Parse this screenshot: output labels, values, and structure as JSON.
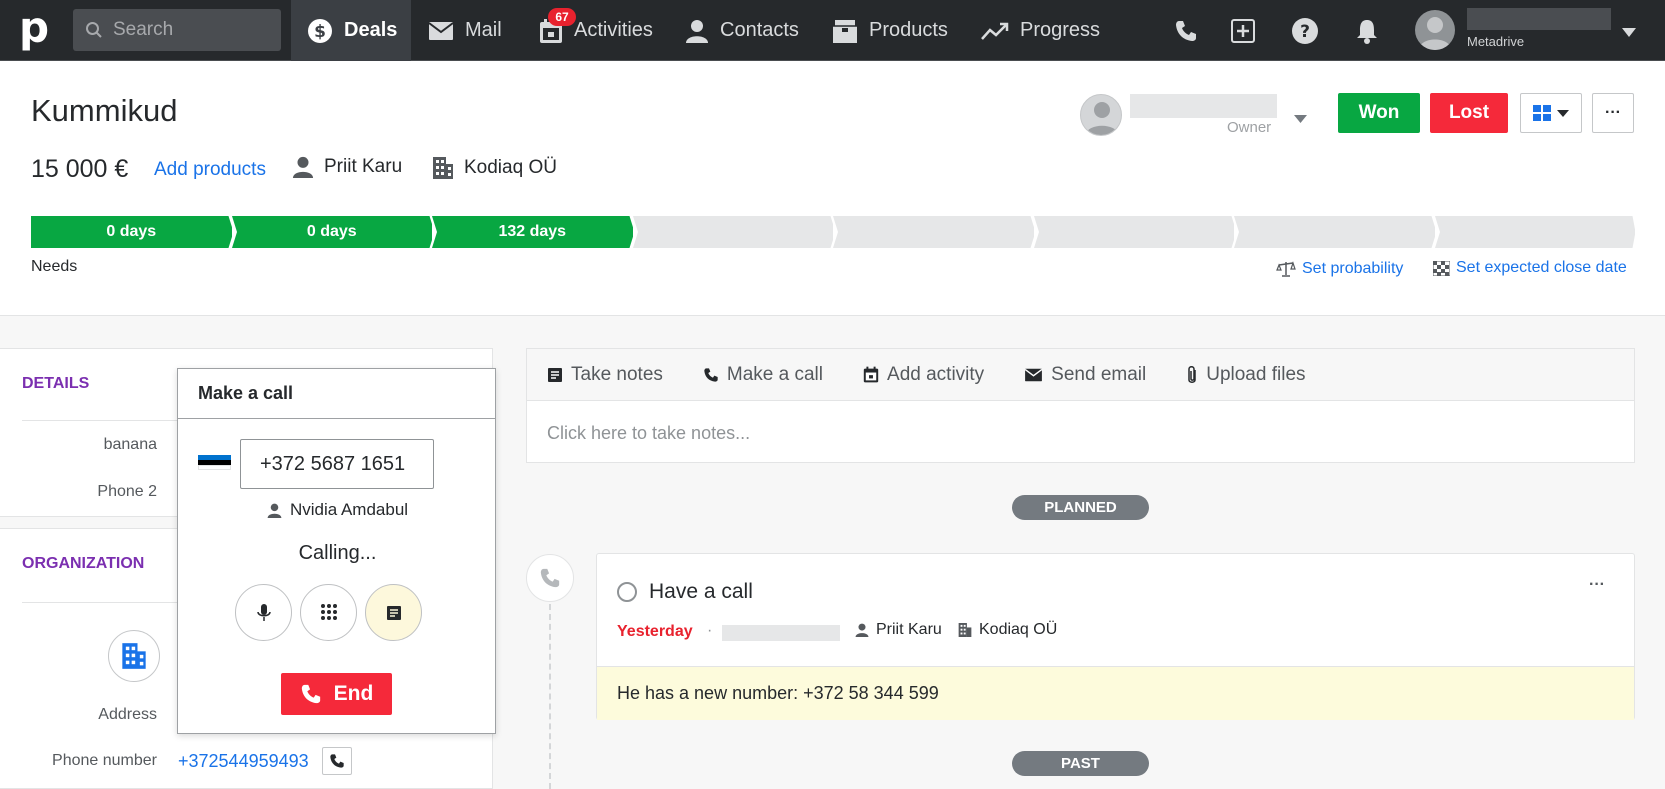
{
  "nav": {
    "search_placeholder": "Search",
    "items": [
      {
        "label": "Deals",
        "icon": "dollar-icon"
      },
      {
        "label": "Mail",
        "icon": "mail-icon"
      },
      {
        "label": "Activities",
        "icon": "calendar-icon",
        "badge": "67"
      },
      {
        "label": "Contacts",
        "icon": "person-icon"
      },
      {
        "label": "Products",
        "icon": "box-icon"
      },
      {
        "label": "Progress",
        "icon": "trend-icon"
      }
    ],
    "user_company": "Metadrive"
  },
  "deal": {
    "title": "Kummikud",
    "value": "15 000 €",
    "add_products": "Add products",
    "person": "Priit Karu",
    "organization": "Kodiaq OÜ",
    "owner_label": "Owner",
    "won": "Won",
    "lost": "Lost",
    "more": "···"
  },
  "pipeline": {
    "stages": [
      "0 days",
      "0 days",
      "132 days",
      "",
      "",
      "",
      "",
      ""
    ],
    "completed_count": 3,
    "current_stage_name": "Needs",
    "set_probability": "Set probability",
    "set_close_date": "Set expected close date"
  },
  "sidebar": {
    "details_title": "DETAILS",
    "details_fields": [
      "banana",
      "Phone 2"
    ],
    "org_title": "ORGANIZATION",
    "org_fields": [
      "Address",
      "Phone number"
    ],
    "phone_number": "+372544959493"
  },
  "call": {
    "title": "Make a call",
    "number": "+372 5687 1651",
    "callee": "Nvidia Amdabul",
    "status": "Calling...",
    "end": "End",
    "flag_colors": [
      "#0072ce",
      "#000000",
      "#ffffff"
    ]
  },
  "composer": {
    "tabs": [
      "Take notes",
      "Make a call",
      "Add activity",
      "Send email",
      "Upload files"
    ],
    "hint": "Click here to take notes..."
  },
  "timeline": {
    "planned": "PLANNED",
    "past": "PAST",
    "activity": {
      "title": "Have a call",
      "when": "Yesterday",
      "separator": "·",
      "person": "Priit Karu",
      "organization": "Kodiaq OÜ",
      "note": "He has a new number: +372 58 344 599",
      "more": "···"
    }
  },
  "colors": {
    "nav_bg": "#26292c",
    "won": "#08a742",
    "lost": "#f5293a",
    "link": "#1a73e8",
    "section_title": "#7b2fb0",
    "stage_done": "#08a742",
    "stage_todo": "#e6e7e8"
  }
}
